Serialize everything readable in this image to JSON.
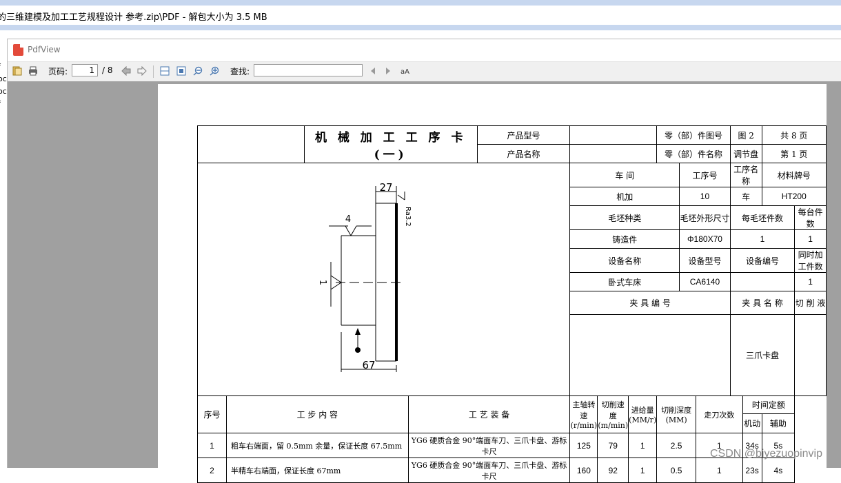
{
  "outer_window": {
    "title": "的三维建模及加工工艺规程设计 参考.zip\\PDF - 解包大小为 3.5 MB"
  },
  "left_strip": [
    "f",
    "oc",
    "oc",
    "f"
  ],
  "app": {
    "title": "PdfView"
  },
  "toolbar": {
    "page_label": "页码:",
    "page_value": "1",
    "page_total": "/ 8",
    "search_label": "查找:",
    "search_value": ""
  },
  "card": {
    "title": "机 械 加 工 工 序 卡(一)",
    "product_model_label": "产品型号",
    "product_model_value": "",
    "product_name_label": "产品名称",
    "product_name_value": "",
    "part_no_label": "零（部）件图号",
    "part_no_value": "图 2",
    "part_name_label": "零（部）件名称",
    "part_name_value": "调节盘",
    "total_pages": "共 8 页",
    "page_no": "第 1 页",
    "head_workshop": "车      间",
    "head_process_no": "工序号",
    "head_process_name": "工序名称",
    "head_material": "材料牌号",
    "workshop": "机加",
    "process_no": "10",
    "process_name": "车",
    "material": "HT200",
    "head_blank_type": "毛坯种类",
    "head_blank_size": "毛坯外形尺寸",
    "head_blank_count": "每毛坯件数",
    "head_per_machine": "每台件数",
    "blank_type": "铸造件",
    "blank_size": "Φ180X70",
    "blank_count": "1",
    "per_machine": "1",
    "head_equip_name": "设备名称",
    "head_equip_model": "设备型号",
    "head_equip_no": "设备编号",
    "head_simul": "同时加工件数",
    "equip_name": "卧式车床",
    "equip_model": "CA6140",
    "equip_no": "",
    "simul": "1",
    "fixture_no_label": "夹  具  编  号",
    "fixture_name_label": "夹  具  名  称",
    "coolant_label": "切 削 液",
    "fixture_name": "三爪卡盘",
    "drawing": {
      "dim_top": "27",
      "dim_bottom": "67",
      "mark_4": "4",
      "mark_1": "1",
      "roughness": "Ra3.2"
    },
    "steps_head": {
      "seq": "序号",
      "content": "工    步    内    容",
      "equipment": "工    艺    装    备",
      "spindle": "主轴转速(r/min)",
      "cut_speed": "切削速度(m/min)",
      "feed": "进给量(MM/r)",
      "depth": "切削深度(MM)",
      "passes": "走刀次数",
      "time": "时间定额",
      "machine_time": "机动",
      "aux_time": "辅助"
    },
    "steps": [
      {
        "seq": "1",
        "content": "粗车右端面，留 0.5mm 余量，保证长度 67.5mm",
        "equipment": "YG6 硬质合金 90°端面车刀、三爪卡盘、游标卡尺",
        "spindle": "125",
        "speed": "79",
        "feed": "1",
        "depth": "2.5",
        "passes": "1",
        "machine": "34s",
        "aux": "5s"
      },
      {
        "seq": "2",
        "content": "半精车右端面，保证长度 67mm",
        "equipment": "YG6 硬质合金 90°端面车刀、三爪卡盘、游标卡尺",
        "spindle": "160",
        "speed": "92",
        "feed": "1",
        "depth": "0.5",
        "passes": "1",
        "machine": "23s",
        "aux": "4s"
      }
    ]
  },
  "watermark": "CSDN @biyezuopinvip"
}
